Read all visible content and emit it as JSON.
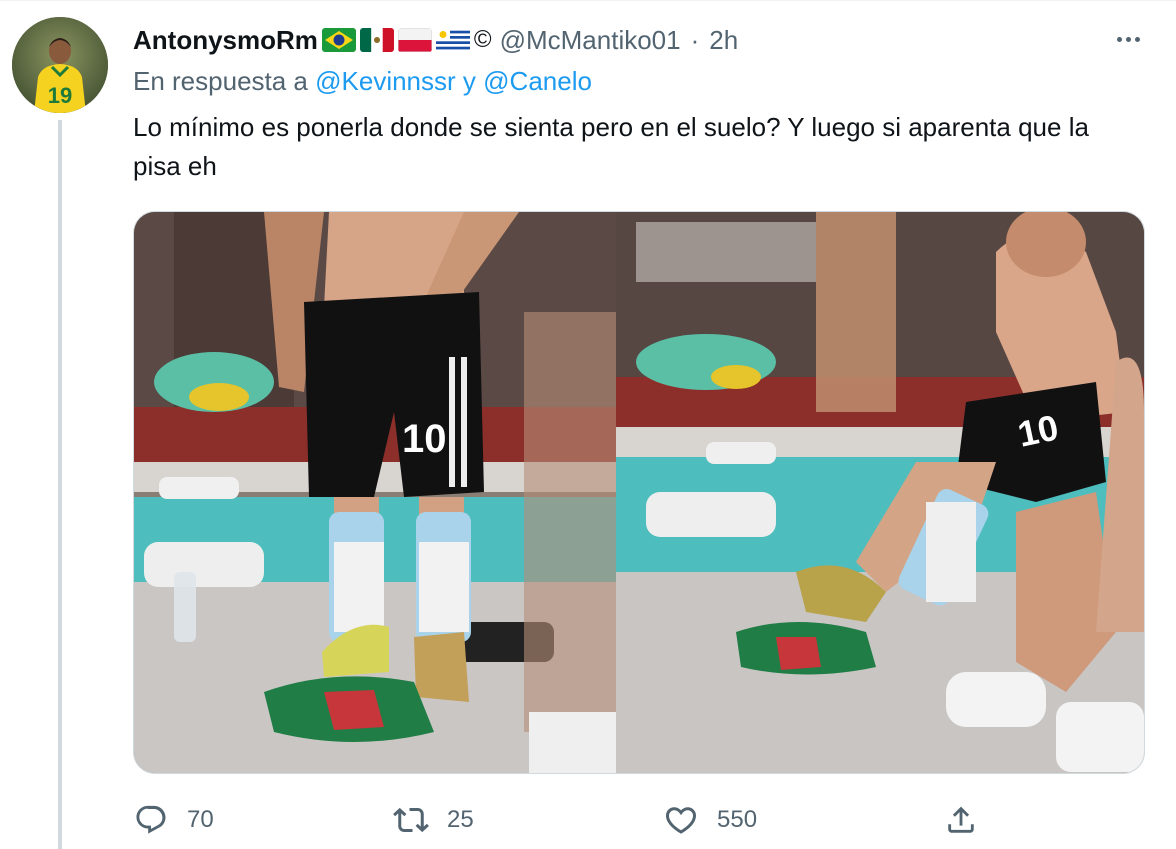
{
  "author": {
    "display_name": "AntonysmoRm",
    "flags": [
      "flag-brazil",
      "flag-mexico",
      "flag-poland",
      "flag-uruguay"
    ],
    "copyright_symbol": "©",
    "handle": "@McMantiko01",
    "separator": "·",
    "time": "2h",
    "avatar_jersey_number": "19"
  },
  "reply": {
    "prefix": "En respuesta a",
    "mention1": "@Kevinnssr",
    "conjunction": "y",
    "mention2": "@Canelo"
  },
  "tweet": {
    "text": "Lo mínimo es ponerla donde se sienta pero en el suelo? Y luego si aparenta que la pisa eh"
  },
  "media": {
    "left_photo_jersey_number": "10",
    "right_photo_jersey_number": "10"
  },
  "actions": {
    "reply_count": "70",
    "retweet_count": "25",
    "like_count": "550"
  },
  "colors": {
    "link": "#1d9bf0",
    "secondary_text": "#536471",
    "primary_text": "#0f1419",
    "border": "#cfd9de"
  }
}
